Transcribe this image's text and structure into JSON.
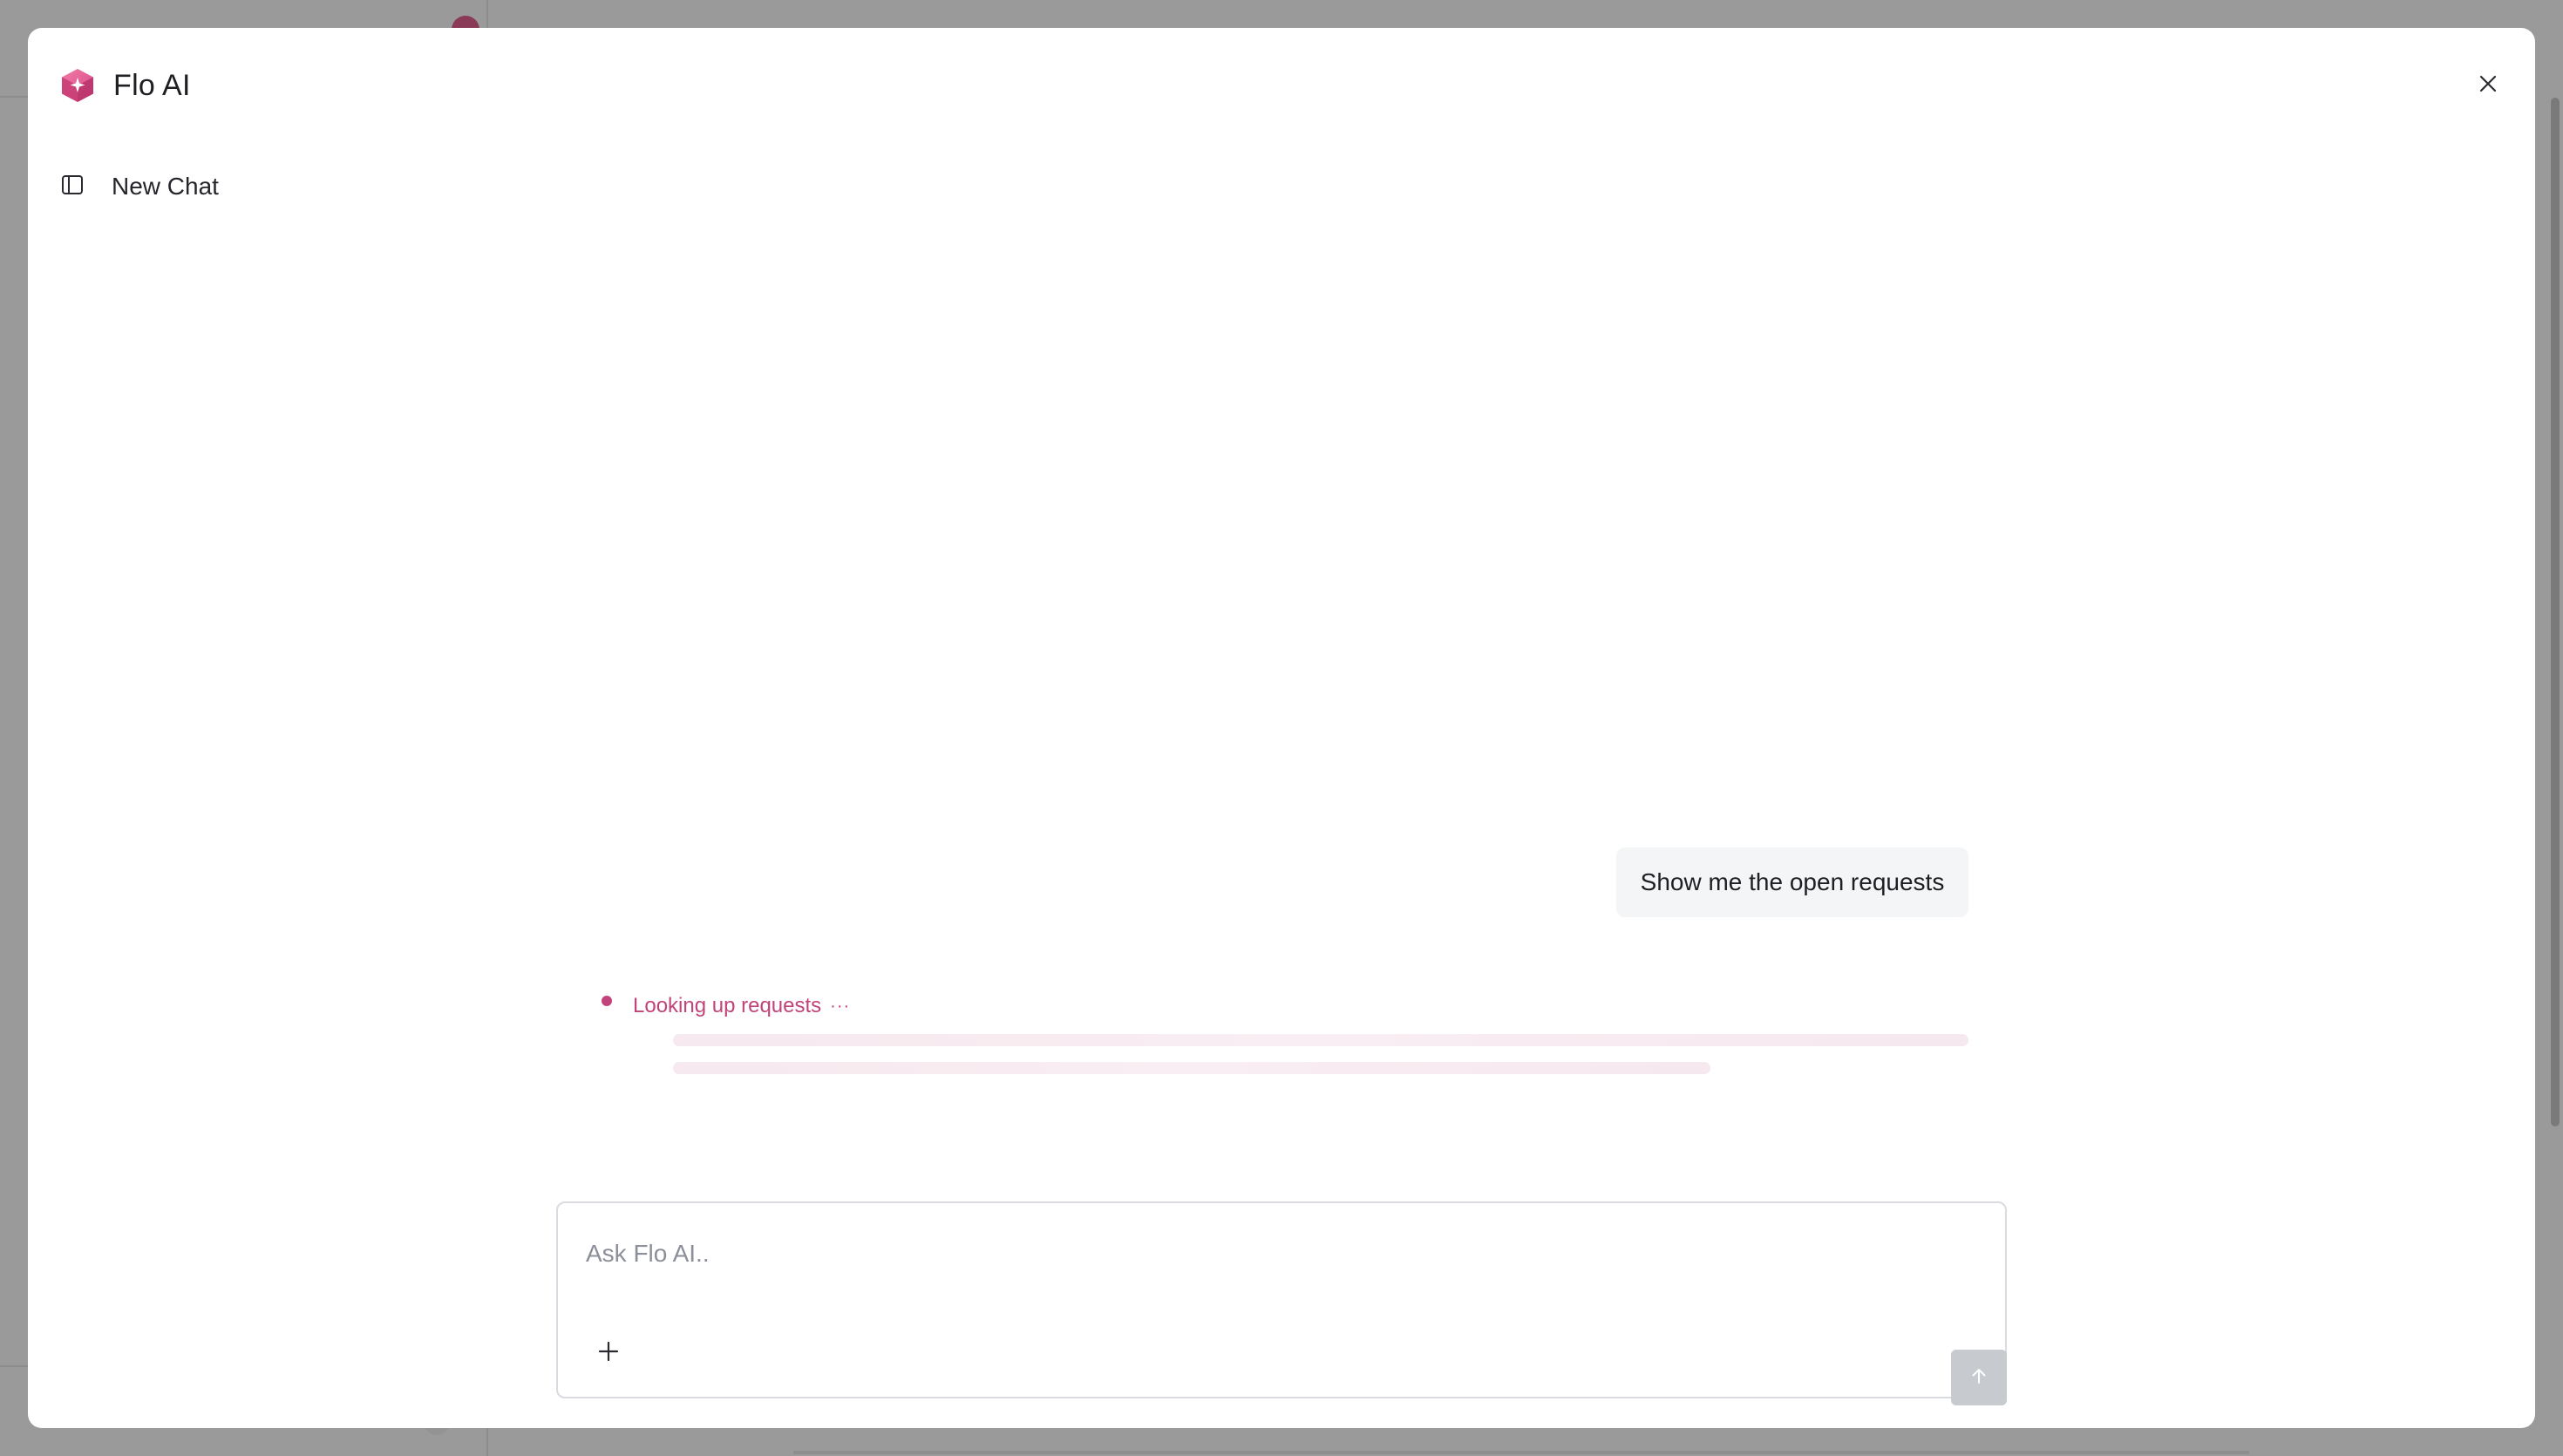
{
  "app": {
    "title": "Flo AI",
    "logo_icon": "flo-ai-cube-sparkle-icon",
    "brand_color": "#d84a83"
  },
  "header": {
    "close_icon": "close-icon"
  },
  "sidebar": {
    "toggle_icon": "sidebar-panel-icon",
    "new_chat_label": "New Chat"
  },
  "conversation": {
    "user_message": "Show me the open requests",
    "status_text": "Looking up requests",
    "status_ellipsis": "···",
    "status_color": "#c2437a"
  },
  "composer": {
    "placeholder": "Ask Flo AI..",
    "value": "",
    "attach_icon": "plus-icon",
    "send_icon": "arrow-up-icon"
  }
}
